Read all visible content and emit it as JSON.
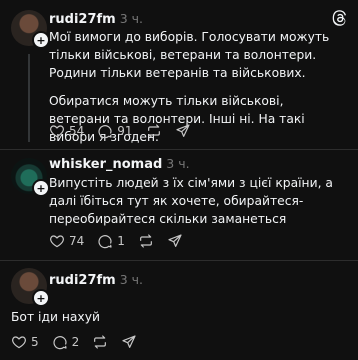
{
  "posts": [
    {
      "username": "rudi27fm",
      "time": "3 ч.",
      "paragraphs": [
        "Мої вимоги до виборів. Голосувати можуть тільки військові, ветерани та волонтери. Родини тільки ветеранів та військових.",
        "Обиратися можуть тільки військові, ветерани та волонтери. Інші ні. На такі вибори я згоден."
      ],
      "likes": "54",
      "replies": "91",
      "reposts": "",
      "shares": ""
    },
    {
      "username": "whisker_nomad",
      "time": "3 ч.",
      "paragraphs": [
        "Випустіть людей з їх сім'ями з цієї країни, а далі їбіться тут як хочете, обирайтеся-переобирайтеся скільки заманеться"
      ],
      "likes": "74",
      "replies": "1",
      "reposts": "",
      "shares": ""
    },
    {
      "username": "rudi27fm",
      "time": "3 ч.",
      "paragraphs": [
        "Бот іди нахуй"
      ],
      "likes": "5",
      "replies": "2",
      "reposts": "",
      "shares": ""
    }
  ],
  "icons": {
    "app_logo": "threads-logo-icon",
    "like": "heart-icon",
    "reply": "comment-icon",
    "repost": "repost-icon",
    "share": "share-icon",
    "follow": "plus-icon",
    "more": "more-dots-icon"
  },
  "colors": {
    "background": "#101010",
    "text": "#f3f5f7",
    "muted": "#777777",
    "thread_line": "#333638"
  }
}
